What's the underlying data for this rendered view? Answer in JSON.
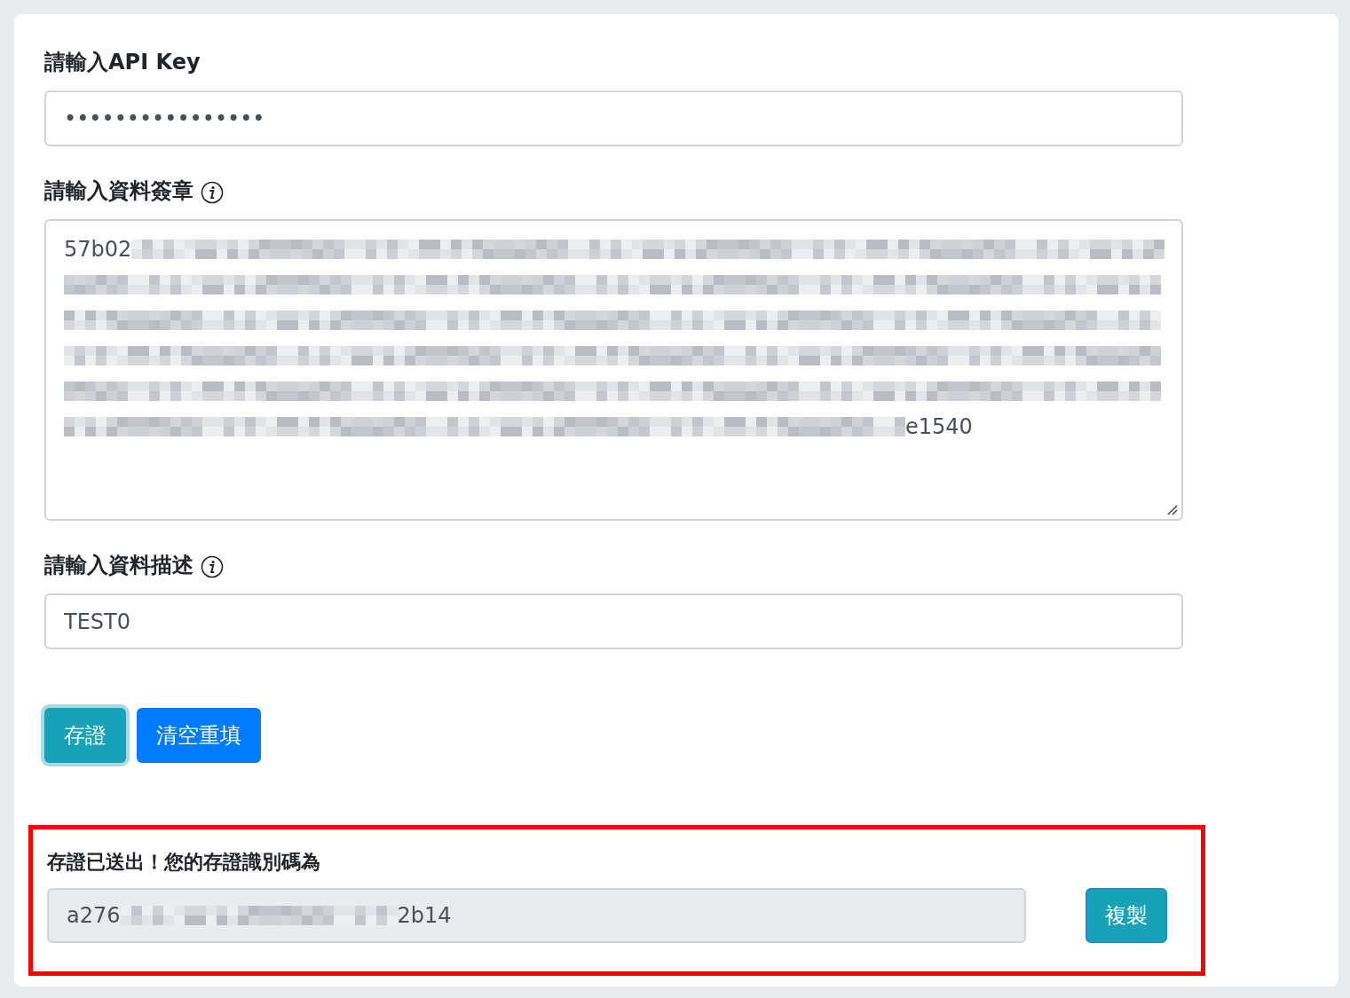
{
  "api_key": {
    "label": "請輸入API Key",
    "value": "••••••••••••••••"
  },
  "signature": {
    "label": "請輸入資料簽章",
    "value_start": "57b02",
    "value_end": "e1540"
  },
  "description": {
    "label": "請輸入資料描述",
    "value": "TEST0"
  },
  "buttons": [
    {
      "label": "存證",
      "kind": "submit",
      "focused": true
    },
    {
      "label": "清空重填",
      "kind": "reset",
      "focused": false
    }
  ],
  "result": {
    "message": "存證已送出！您的存證識別碼為",
    "id_start": "a276",
    "id_end": "2b14",
    "copy_button": "複製",
    "highlighted": true
  }
}
